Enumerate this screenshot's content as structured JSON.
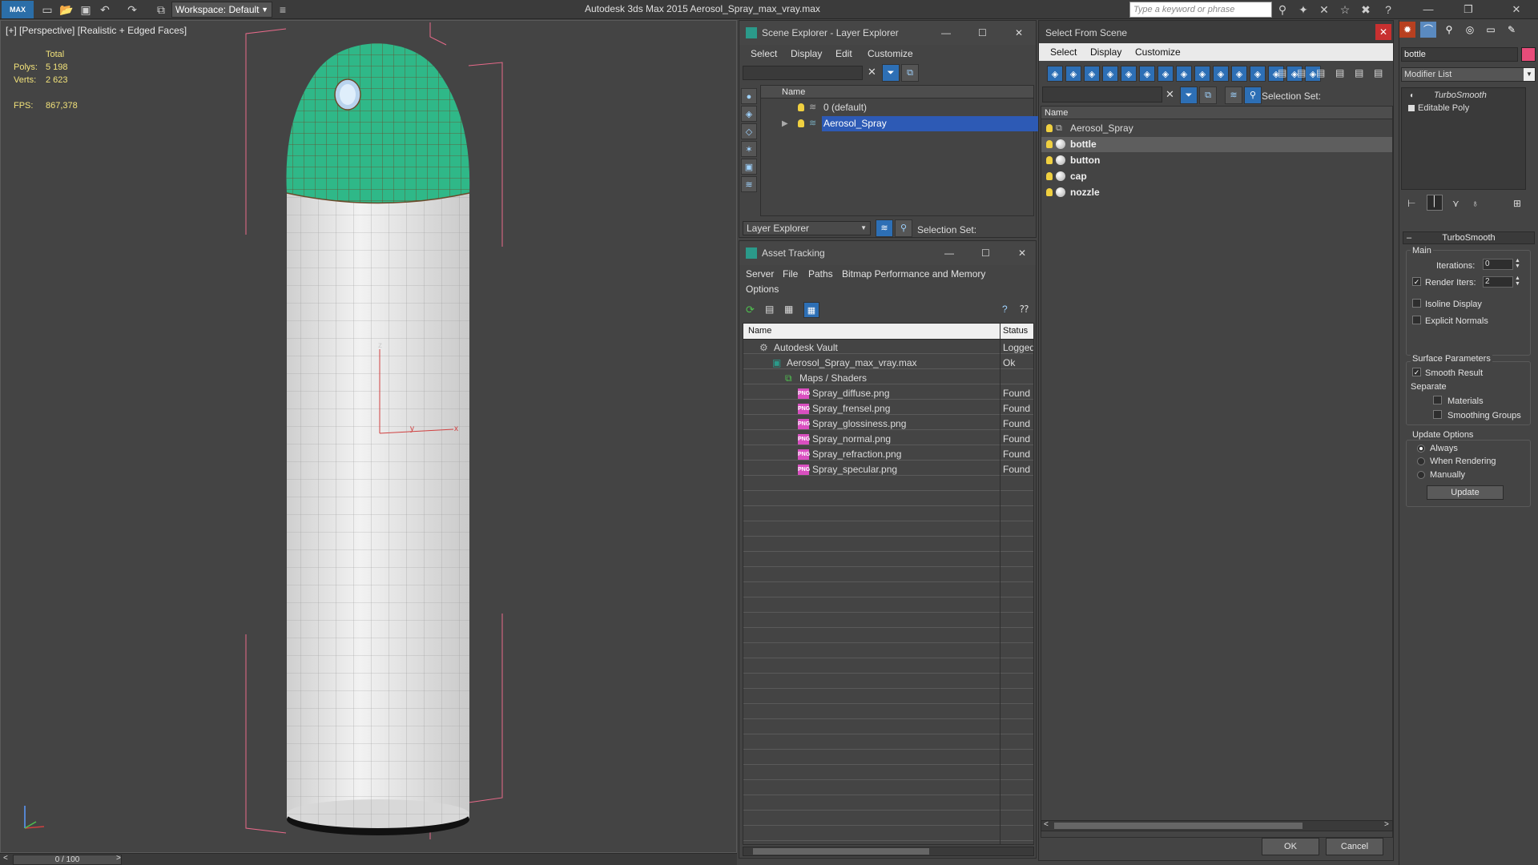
{
  "app": {
    "title": "Autodesk 3ds Max  2015     Aerosol_Spray_max_vray.max",
    "workspace": "Workspace: Default",
    "search_placeholder": "Type a keyword or phrase",
    "logo": "MAX"
  },
  "viewport": {
    "label": "[+] [Perspective] [Realistic + Edged Faces]",
    "stats": {
      "total_label": "Total",
      "polys_label": "Polys:",
      "polys": "5 198",
      "verts_label": "Verts:",
      "verts": "2 623",
      "fps_label": "FPS:",
      "fps": "867,378"
    },
    "axis": {
      "z": "z",
      "y": "y",
      "x": "x"
    },
    "timeline": "0 / 100",
    "colors": {
      "cap": "#2fb888",
      "bottle": "#e4e4e4",
      "bbox": "#e86a8a"
    }
  },
  "scene_explorer": {
    "title": "Scene Explorer - Layer Explorer",
    "menu": [
      "Select",
      "Display",
      "Edit",
      "Customize"
    ],
    "column": "Name",
    "rows": [
      "0 (default)",
      "Aerosol_Spray"
    ],
    "footer_dropdown": "Layer Explorer",
    "selection_set": "Selection Set:"
  },
  "asset_tracking": {
    "title": "Asset Tracking",
    "menu": [
      "Server",
      "File",
      "Paths",
      "Bitmap Performance and Memory",
      "Options"
    ],
    "columns": [
      "Name",
      "Status"
    ],
    "rows": [
      {
        "name": "Autodesk Vault",
        "status": "Logged",
        "indent": 0,
        "icon": "vault-icon"
      },
      {
        "name": "Aerosol_Spray_max_vray.max",
        "status": "Ok",
        "indent": 1,
        "icon": "max-file-icon"
      },
      {
        "name": "Maps / Shaders",
        "status": "",
        "indent": 2,
        "icon": "maps-icon"
      },
      {
        "name": "Spray_diffuse.png",
        "status": "Found",
        "indent": 3,
        "icon": "png-icon"
      },
      {
        "name": "Spray_frensel.png",
        "status": "Found",
        "indent": 3,
        "icon": "png-icon"
      },
      {
        "name": "Spray_glossiness.png",
        "status": "Found",
        "indent": 3,
        "icon": "png-icon"
      },
      {
        "name": "Spray_normal.png",
        "status": "Found",
        "indent": 3,
        "icon": "png-icon"
      },
      {
        "name": "Spray_refraction.png",
        "status": "Found",
        "indent": 3,
        "icon": "png-icon"
      },
      {
        "name": "Spray_specular.png",
        "status": "Found",
        "indent": 3,
        "icon": "png-icon"
      }
    ]
  },
  "select_from_scene": {
    "title": "Select From Scene",
    "menu": [
      "Select",
      "Display",
      "Customize"
    ],
    "selection_set": "Selection Set:",
    "column": "Name",
    "rows": [
      "Aerosol_Spray",
      "bottle",
      "button",
      "cap",
      "nozzle"
    ],
    "ok": "OK",
    "cancel": "Cancel"
  },
  "command_panel": {
    "object_name": "bottle",
    "modifier_list": "Modifier List",
    "stack": [
      "TurboSmooth",
      "Editable Poly"
    ],
    "turbosmooth": {
      "title": "TurboSmooth",
      "main": "Main",
      "iterations_label": "Iterations:",
      "iterations": "0",
      "render_iters_label": "Render Iters:",
      "render_iters": "2",
      "isoline": "Isoline Display",
      "explicit_normals": "Explicit Normals",
      "surface_params": "Surface Parameters",
      "smooth_result": "Smooth Result",
      "separate": "Separate",
      "materials": "Materials",
      "smoothing_groups": "Smoothing Groups",
      "update_options": "Update Options",
      "always": "Always",
      "when_rendering": "When Rendering",
      "manually": "Manually",
      "update": "Update"
    }
  }
}
